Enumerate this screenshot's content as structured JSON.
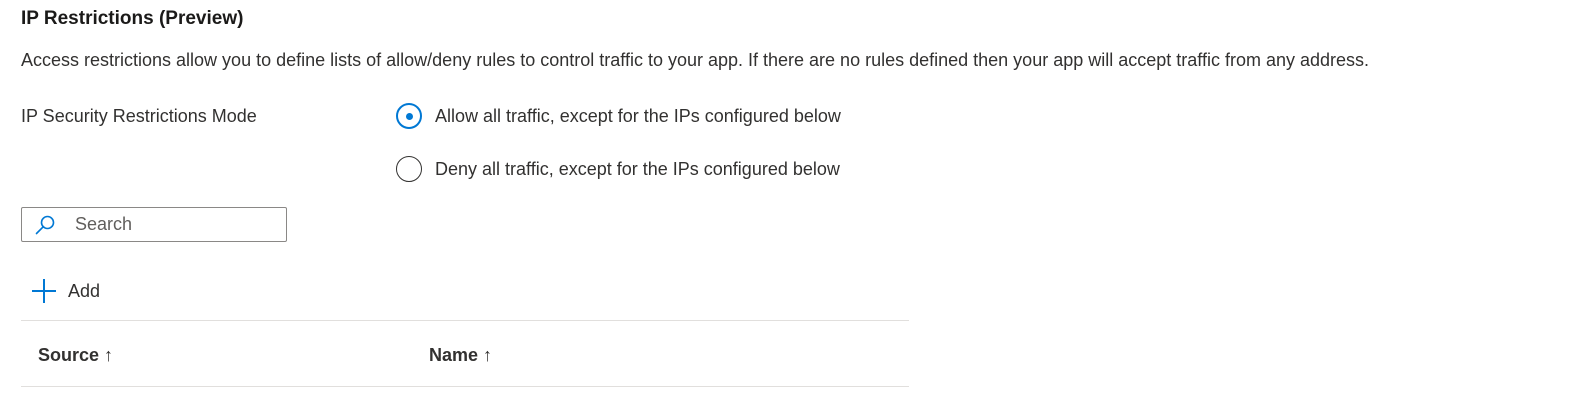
{
  "title": "IP Restrictions (Preview)",
  "description": "Access restrictions allow you to define lists of allow/deny rules to control traffic to your app. If there are no rules defined then your app will accept traffic from any address.",
  "mode": {
    "label": "IP Security Restrictions Mode",
    "options": [
      {
        "label": "Allow all traffic, except for the IPs configured below",
        "checked": true
      },
      {
        "label": "Deny all traffic, except for the IPs configured below",
        "checked": false
      }
    ]
  },
  "search": {
    "placeholder": "Search",
    "value": ""
  },
  "toolbar": {
    "add_label": "Add"
  },
  "table": {
    "columns": [
      {
        "label": "Source",
        "sort": "↑"
      },
      {
        "label": "Name",
        "sort": "↑"
      }
    ]
  },
  "colors": {
    "accent": "#0078d4",
    "text": "#323130",
    "border": "#8a8886",
    "divider": "#e1dfdd"
  },
  "icons": {
    "search": "search-icon",
    "add": "plus-icon",
    "sort": "sort-ascending-icon"
  }
}
